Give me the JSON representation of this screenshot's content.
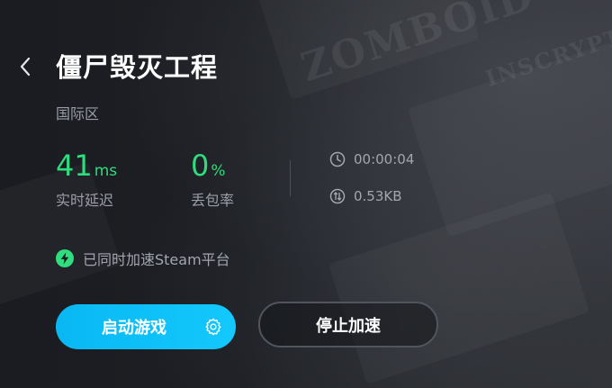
{
  "game": {
    "title": "僵尸毁灭工程",
    "region": "国际区"
  },
  "stats": {
    "latency_value": "41",
    "latency_unit": "ms",
    "latency_label": "实时延迟",
    "loss_value": "0",
    "loss_unit": "%",
    "loss_label": "丢包率"
  },
  "info": {
    "duration": "00:00:04",
    "traffic": "0.53KB"
  },
  "notice": {
    "text": "已同时加速Steam平台"
  },
  "actions": {
    "start_label": "启动游戏",
    "stop_label": "停止加速"
  },
  "background": {
    "watermark_1": "INSCRYPTION",
    "watermark_2": "ZOMBOID"
  },
  "colors": {
    "accent_green": "#2fdc7e",
    "primary_button": "#13c8fc",
    "text_muted": "#9b9ea5"
  }
}
